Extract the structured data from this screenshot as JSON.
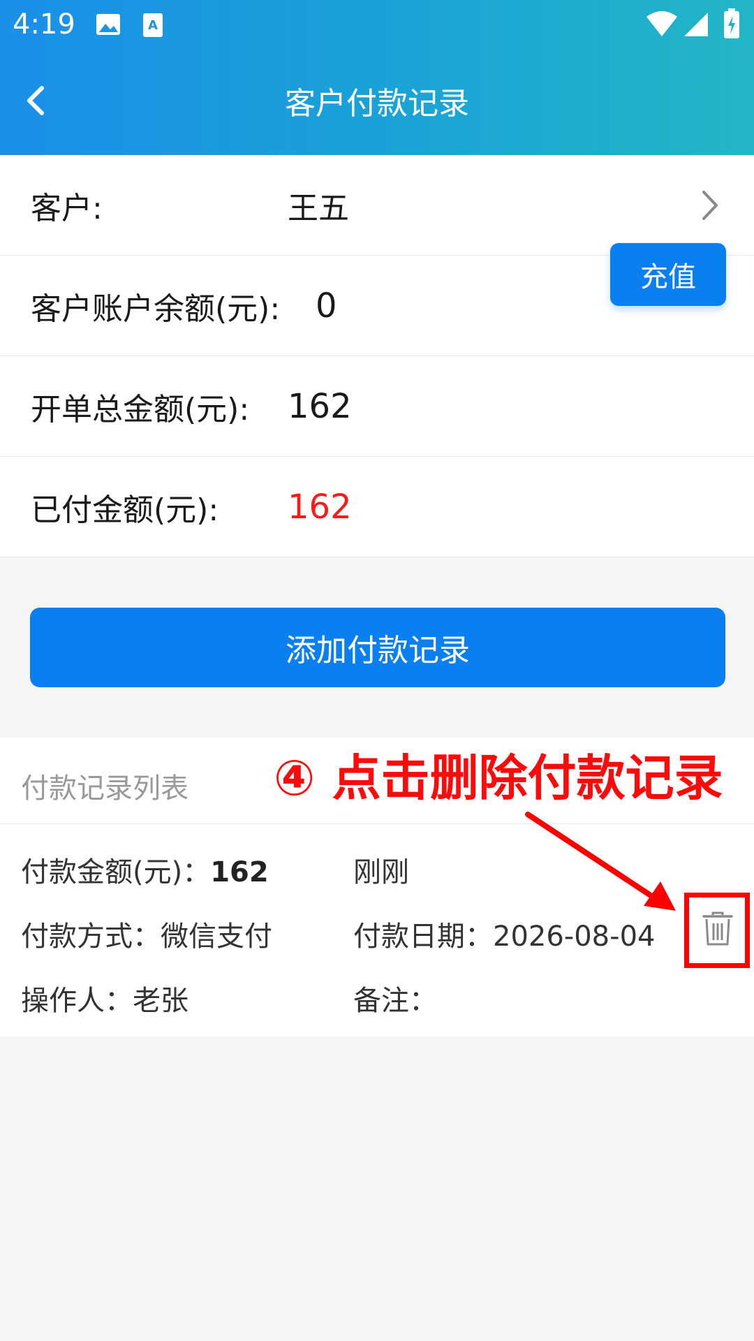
{
  "status_bar": {
    "time": "4:19"
  },
  "header": {
    "title": "客户付款记录"
  },
  "info": {
    "customer_label": "客户:",
    "customer_value": "王五",
    "balance_label": "客户账户余额(元):",
    "balance_value": "0",
    "recharge_label": "充值",
    "total_label": "开单总金额(元):",
    "total_value": "162",
    "paid_label": "已付金额(元):",
    "paid_value": "162"
  },
  "add_button_label": "添加付款记录",
  "list": {
    "title": "付款记录列表",
    "record": {
      "amount_label": "付款金额(元)：",
      "amount_value": "162",
      "time": "刚刚",
      "method_label": "付款方式：",
      "method_value": "微信支付",
      "date_label": "付款日期：",
      "date_value": "2026-08-04",
      "operator_label": "操作人：",
      "operator_value": "老张",
      "note_label": "备注："
    }
  },
  "annotation": {
    "text": "④ 点击删除付款记录",
    "color": "#ff0000"
  },
  "colors": {
    "accent": "#0a7ff0",
    "paid": "#ff1a1a"
  },
  "icons": [
    "back-icon",
    "chevron-right-icon",
    "trash-icon",
    "wifi-icon",
    "signal-icon",
    "battery-icon",
    "image-icon",
    "font-icon"
  ]
}
